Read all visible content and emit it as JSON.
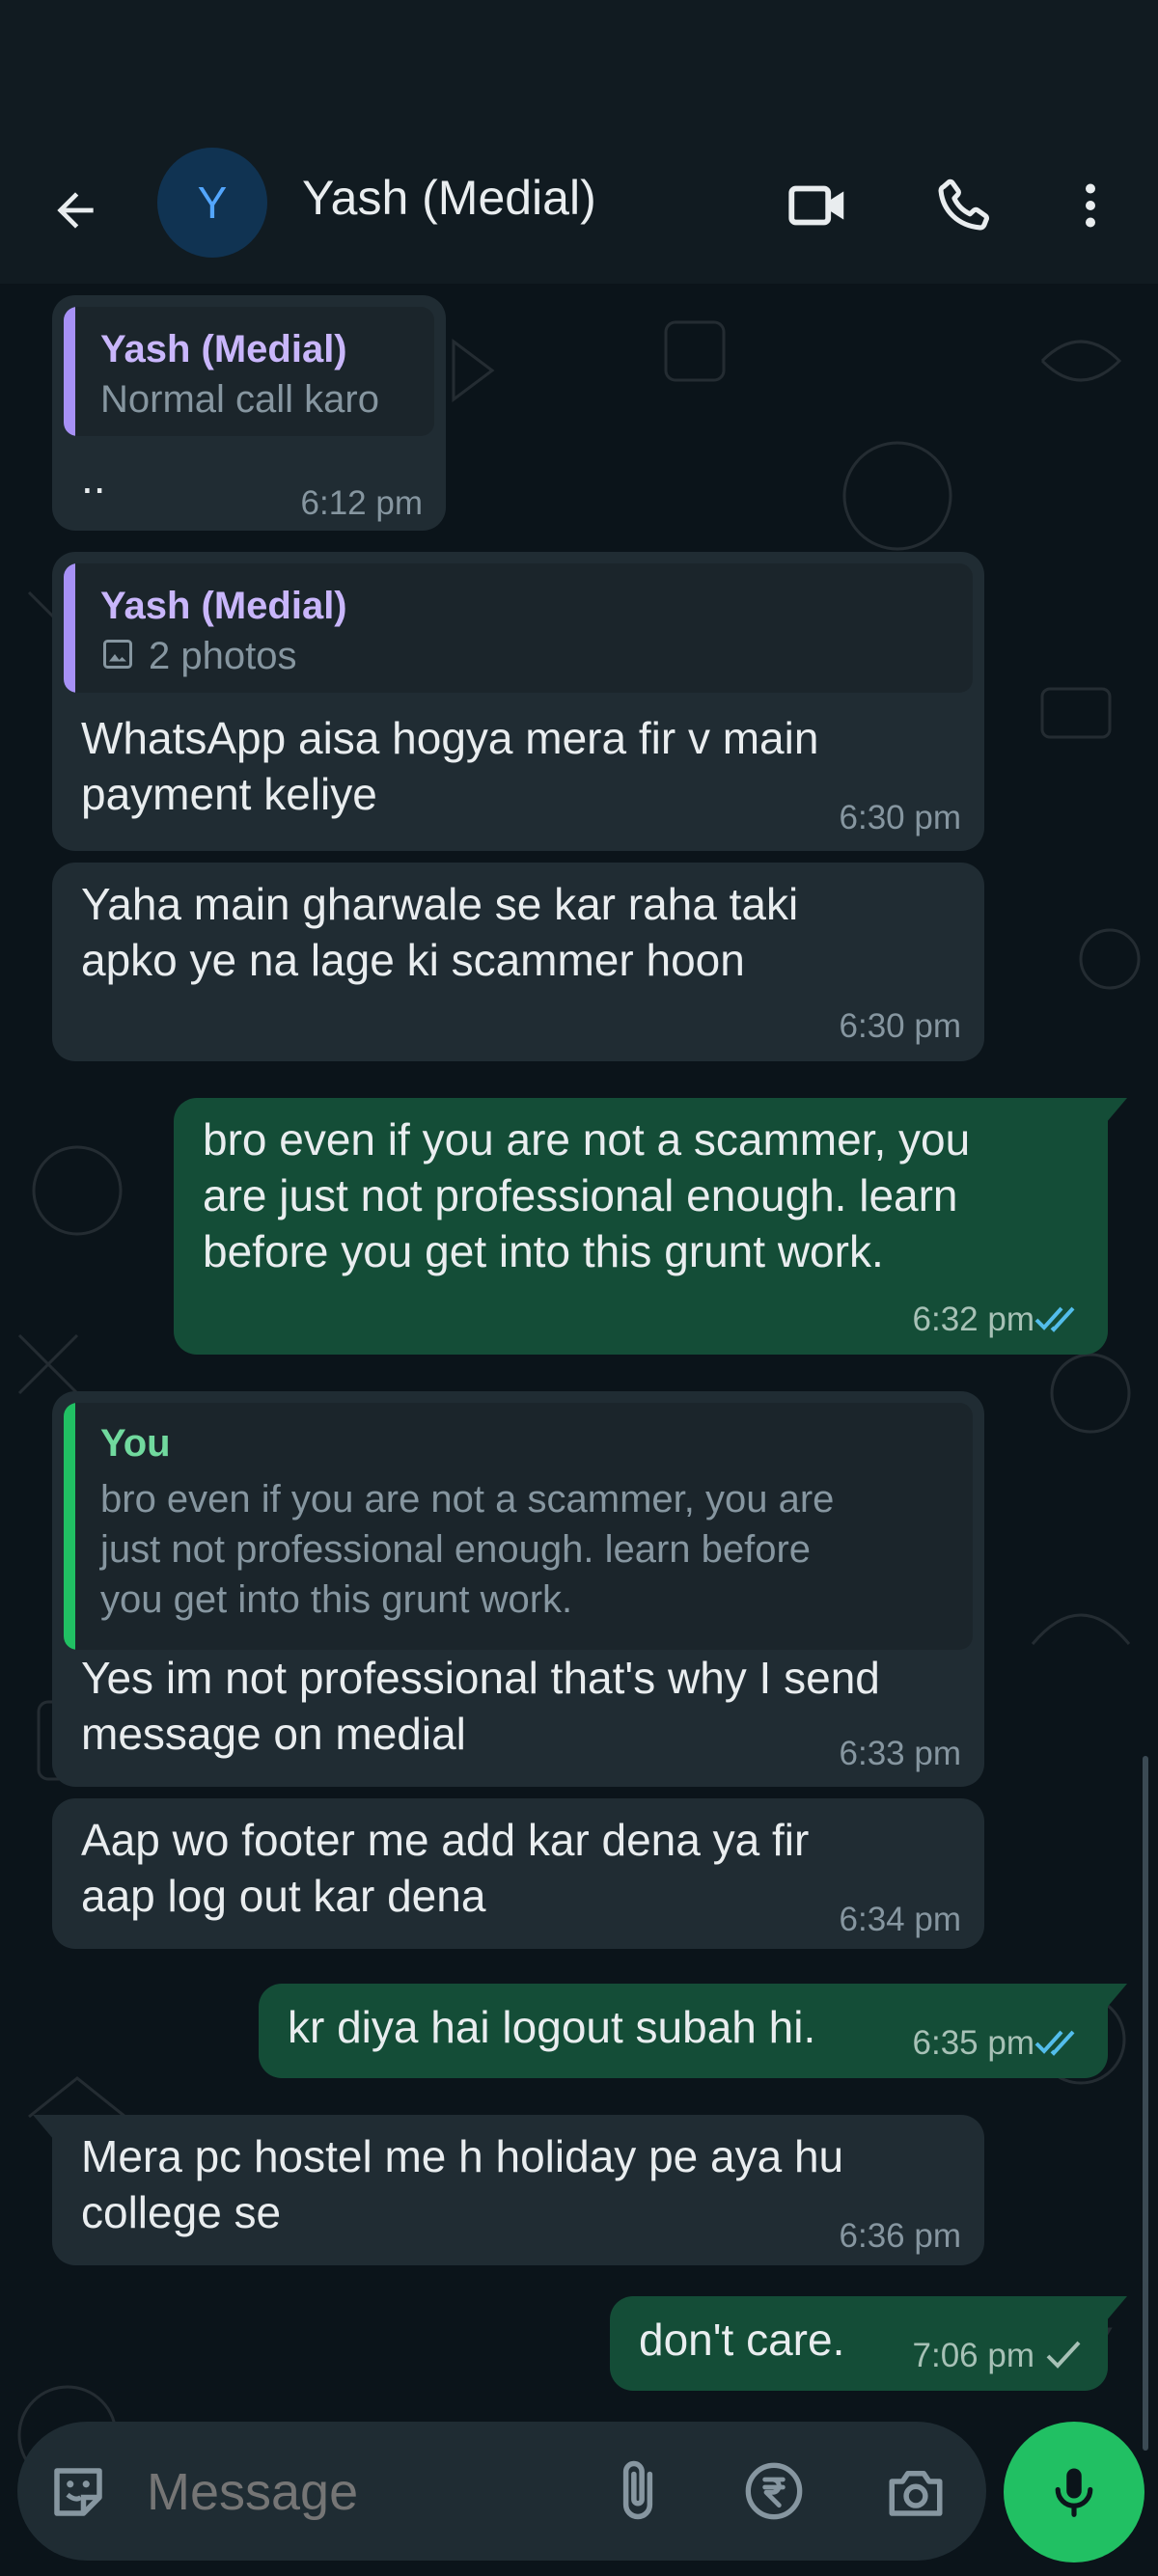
{
  "header": {
    "avatar_initial": "Y",
    "contact_name": "Yash (Medial)",
    "back_icon": "back-arrow-icon",
    "video_icon": "video-call-icon",
    "call_icon": "phone-icon",
    "menu_icon": "more-vert-icon"
  },
  "messages": [
    {
      "direction": "in",
      "quote_name": "Yash (Medial)",
      "quote_text": "Normal call karo",
      "text": "..",
      "time": "6:12 pm"
    },
    {
      "direction": "in",
      "quote_name": "Yash (Medial)",
      "quote_text": "2 photos",
      "text_lines": [
        "WhatsApp aisa hogya mera fir v main",
        "payment keliye"
      ],
      "time": "6:30 pm"
    },
    {
      "direction": "in",
      "text_lines": [
        "Yaha main gharwale se kar raha taki",
        "apko ye na lage ki scammer hoon"
      ],
      "time": "6:30 pm"
    },
    {
      "direction": "out",
      "text_lines": [
        "bro even if you are not a scammer, you",
        "are just not professional enough. learn",
        "before you get into this grunt work."
      ],
      "time": "6:32 pm",
      "status": "read"
    },
    {
      "direction": "in",
      "quote_name": "You",
      "quote_lines": [
        "bro even if you are not a scammer, you are",
        "just not professional enough. learn before",
        "you get into this grunt work."
      ],
      "text_lines": [
        "Yes im not professional that's why I send",
        "message on medial"
      ],
      "time": "6:33 pm"
    },
    {
      "direction": "in",
      "text_lines": [
        "Aap wo footer me add kar dena ya fir",
        "aap log out kar dena"
      ],
      "time": "6:34 pm"
    },
    {
      "direction": "out",
      "text": "kr diya hai logout subah hi.",
      "time": "6:35 pm",
      "status": "read"
    },
    {
      "direction": "in",
      "text_lines": [
        "Mera pc hostel me h holiday pe aya hu",
        "college se"
      ],
      "time": "6:36 pm"
    },
    {
      "direction": "out",
      "text": "don't care.",
      "time": "7:06 pm",
      "status": "sent"
    }
  ],
  "composer": {
    "placeholder": "Message",
    "emoji_icon": "sticker-emoji-icon",
    "attach_icon": "paperclip-icon",
    "payment_icon": "rupee-icon",
    "camera_icon": "camera-icon",
    "mic_icon": "microphone-icon"
  },
  "colors": {
    "incoming_bubble": "#202c33",
    "outgoing_bubble": "#144d37",
    "quote_bar_contact": "#a791f6",
    "quote_bar_you": "#21c063",
    "read_ticks": "#53bdeb",
    "mic_button": "#21c063"
  }
}
